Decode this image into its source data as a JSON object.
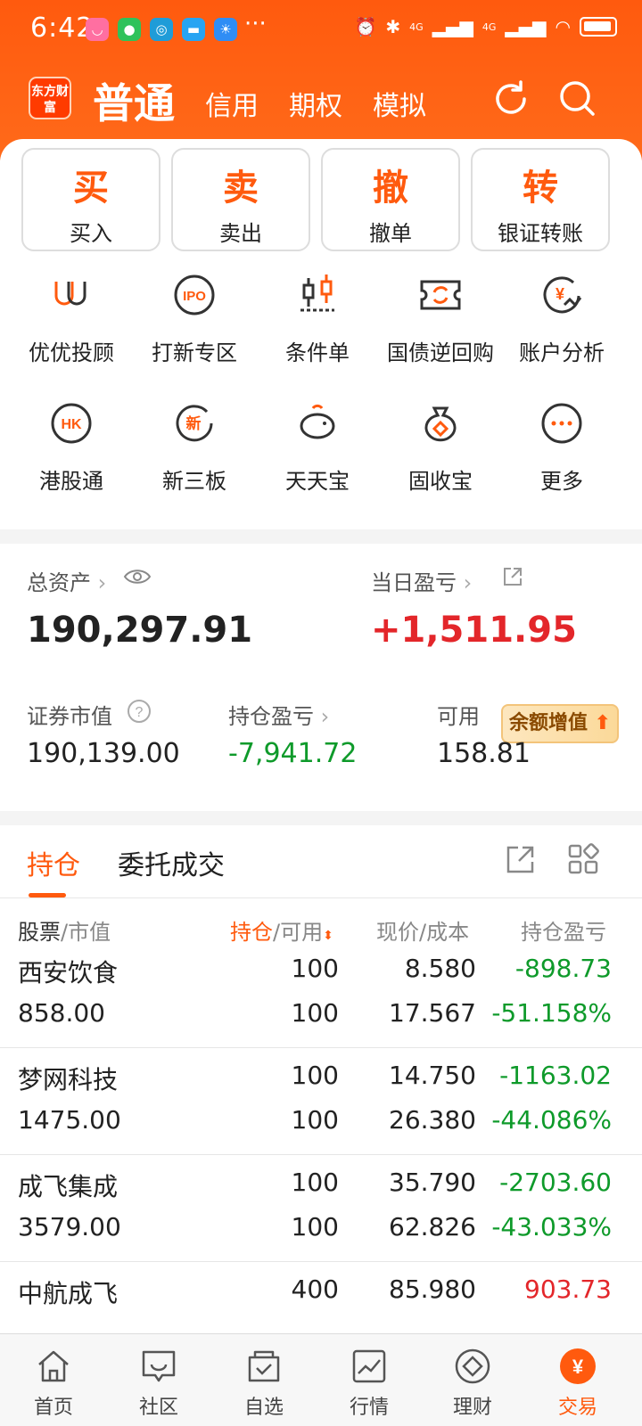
{
  "status_bar": {
    "time": "6:42",
    "signal_1": "4G",
    "signal_2": "4G"
  },
  "header": {
    "logo_text": "东方财富",
    "tabs": [
      {
        "label": "普通"
      },
      {
        "label": "信用"
      },
      {
        "label": "期权"
      },
      {
        "label": "模拟"
      }
    ],
    "icons": [
      "refresh-icon",
      "search-icon"
    ]
  },
  "actions": [
    {
      "char": "买",
      "label": "买入"
    },
    {
      "char": "卖",
      "label": "卖出"
    },
    {
      "char": "撤",
      "label": "撤单"
    },
    {
      "char": "转",
      "label": "银证转账"
    }
  ],
  "grid": [
    {
      "label": "优优投顾",
      "icon": "uu-advisor-icon"
    },
    {
      "label": "打新专区",
      "icon": "ipo-icon"
    },
    {
      "label": "条件单",
      "icon": "candlestick-icon"
    },
    {
      "label": "国债逆回购",
      "icon": "repo-ticket-icon"
    },
    {
      "label": "账户分析",
      "icon": "yen-analysis-icon"
    },
    {
      "label": "港股通",
      "icon": "hk-icon"
    },
    {
      "label": "新三板",
      "icon": "new-board-icon"
    },
    {
      "label": "天天宝",
      "icon": "piggy-bank-icon"
    },
    {
      "label": "固收宝",
      "icon": "money-bag-icon"
    },
    {
      "label": "更多",
      "icon": "more-dots-icon"
    }
  ],
  "asset": {
    "total_label": "总资产",
    "total_value": "190,297.91",
    "daily_pl_label": "当日盈亏",
    "daily_pl_value": "+1,511.95",
    "market_value_label": "证券市值",
    "market_value": "190,139.00",
    "position_pl_label": "持仓盈亏",
    "position_pl_value": "-7,941.72",
    "available_label": "可用",
    "available_value": "158.81",
    "promo_label": "余额增值"
  },
  "holdings": {
    "tabs": [
      {
        "label": "持仓"
      },
      {
        "label": "委托成交"
      }
    ],
    "columns": {
      "c1a": "股票",
      "c1b": "/市值",
      "c2a": "持仓",
      "c2b": "/可用",
      "c3": "现价/成本",
      "c4": "持仓盈亏"
    },
    "rows": [
      {
        "name": "西安饮食",
        "market_value": "858.00",
        "hold": "100",
        "avail": "100",
        "price": "8.580",
        "cost": "17.567",
        "pl": "-898.73",
        "pl_pct": "-51.158%"
      },
      {
        "name": "梦网科技",
        "market_value": "1475.00",
        "hold": "100",
        "avail": "100",
        "price": "14.750",
        "cost": "26.380",
        "pl": "-1163.02",
        "pl_pct": "-44.086%"
      },
      {
        "name": "成飞集成",
        "market_value": "3579.00",
        "hold": "100",
        "avail": "100",
        "price": "35.790",
        "cost": "62.826",
        "pl": "-2703.60",
        "pl_pct": "-43.033%"
      },
      {
        "name": "中航成飞",
        "market_value": "",
        "hold": "400",
        "avail": "",
        "price": "85.980",
        "cost": "",
        "pl": "903.73",
        "pl_pct": ""
      }
    ]
  },
  "bottom_nav": [
    {
      "label": "首页",
      "icon": "home-icon"
    },
    {
      "label": "社区",
      "icon": "community-icon"
    },
    {
      "label": "自选",
      "icon": "watchlist-icon"
    },
    {
      "label": "行情",
      "icon": "market-chart-icon"
    },
    {
      "label": "理财",
      "icon": "wealth-diamond-icon"
    },
    {
      "label": "交易",
      "icon": "trade-yen-icon"
    }
  ]
}
